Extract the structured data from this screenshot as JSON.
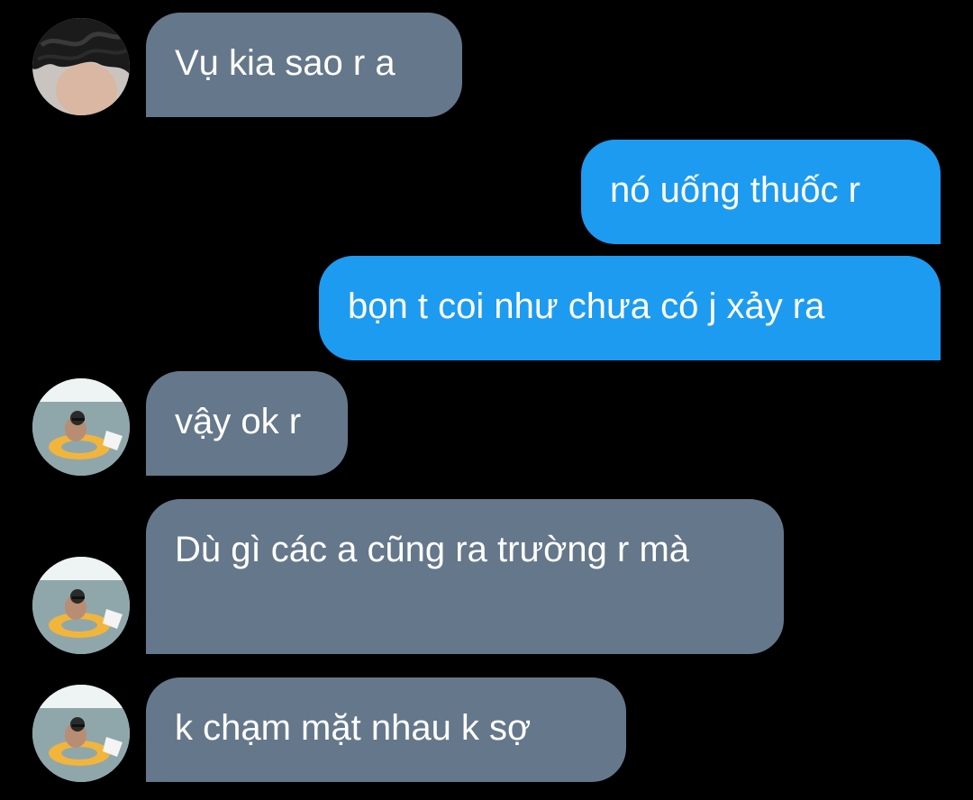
{
  "messages": [
    {
      "sender": "other",
      "avatar": "dark-hair-avatar",
      "text": "Vụ kia sao r a"
    },
    {
      "sender": "me",
      "text": "nó uống thuốc r"
    },
    {
      "sender": "me",
      "text": "bọn t coi như chưa có j xảy ra"
    },
    {
      "sender": "other",
      "avatar": "beach-float-avatar",
      "text": "vậy ok r"
    },
    {
      "sender": "other",
      "avatar": "beach-float-avatar",
      "text": "Dù gì các a cũng ra trường r mà"
    },
    {
      "sender": "other",
      "avatar": "beach-float-avatar",
      "text": "k chạm mặt nhau k sợ"
    }
  ],
  "colors": {
    "background": "#000000",
    "incoming_bubble": "#65778a",
    "outgoing_bubble": "#1d9bf0",
    "text": "#ffffff"
  }
}
